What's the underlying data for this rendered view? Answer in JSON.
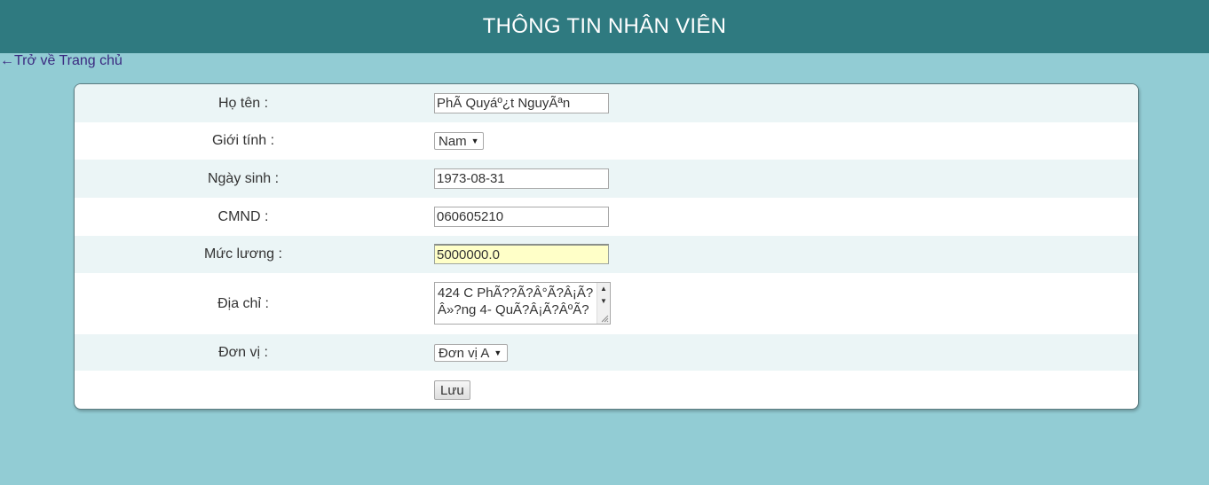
{
  "header": {
    "title": "THÔNG TIN NHÂN VIÊN"
  },
  "nav": {
    "back_link": "←Trở về Trang chủ"
  },
  "form": {
    "name": {
      "label": "Họ tên :",
      "value": "PhÃ Quyáº¿t NguyÃªn"
    },
    "gender": {
      "label": "Giới tính :",
      "selected": "Nam"
    },
    "birthdate": {
      "label": "Ngày sinh :",
      "value": "1973-08-31"
    },
    "id_card": {
      "label": "CMND :",
      "value": "060605210"
    },
    "salary": {
      "label": "Mức lương :",
      "value": "5000000.0"
    },
    "address": {
      "label": "Địa chỉ :",
      "value": "424 C PhÃ??Ã?Â°Ã?Â¡Ã?Â»?ng 4- QuÃ?Â¡Ã?ÂºÃ?"
    },
    "unit": {
      "label": "Đơn vị :",
      "selected": "Đơn vị A"
    },
    "save_button": "Lưu"
  },
  "colors": {
    "header_bg": "#2f7a80",
    "page_bg": "#92ccd4",
    "row_alt_bg": "#ebf5f6",
    "focused_input_bg": "#ffffc8",
    "link": "#3b2a80"
  }
}
